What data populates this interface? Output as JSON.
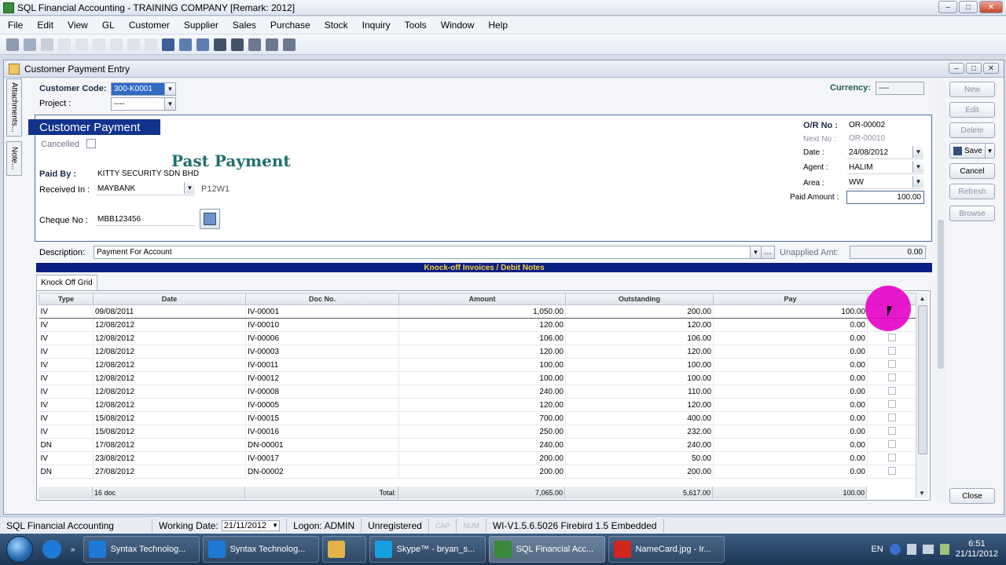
{
  "app": {
    "title": "SQL Financial Accounting - TRAINING COMPANY [Remark: 2012]",
    "window_buttons": [
      "–",
      "□",
      "✕"
    ]
  },
  "menu": [
    "File",
    "Edit",
    "View",
    "GL",
    "Customer",
    "Supplier",
    "Sales",
    "Purchase",
    "Stock",
    "Inquiry",
    "Tools",
    "Window",
    "Help"
  ],
  "child_window": {
    "title": "Customer Payment Entry",
    "side_tabs": [
      "Attachments...",
      "Note..."
    ]
  },
  "header": {
    "customer_code_label": "Customer Code:",
    "customer_code": "300-K0001",
    "project_label": "Project :",
    "project": "----",
    "currency_label": "Currency:",
    "currency": "----"
  },
  "form": {
    "section_title": "Customer Payment",
    "cancelled_label": "Cancelled",
    "watermark": "Past Payment",
    "paid_by_label": "Paid By :",
    "paid_by": "KITTY SECURITY SDN BHD",
    "received_in_label": "Received In :",
    "received_in": "MAYBANK",
    "received_in_code": "P12W1",
    "cheque_no_label": "Cheque No :",
    "cheque_no": "MBB123456",
    "or_no_label": "O/R No :",
    "or_no": "OR-00002",
    "next_no_label": "Next No :",
    "next_no": "OR-00010",
    "date_label": "Date :",
    "date": "24/08/2012",
    "agent_label": "Agent :",
    "agent": "HALIM",
    "area_label": "Area :",
    "area": "WW",
    "paid_amount_label": "Paid Amount :",
    "paid_amount": "100.00",
    "description_label": "Description:",
    "description": "Payment For Account",
    "unapplied_label": "Unapplied Amt:",
    "unapplied": "0.00",
    "ellipsis": "…"
  },
  "actions": {
    "new": "New",
    "edit": "Edit",
    "delete": "Delete",
    "save": "Save",
    "cancel": "Cancel",
    "refresh": "Refresh",
    "browse": "Browse",
    "close": "Close"
  },
  "knockoff": {
    "bar_title": "Knock-off Invoices / Debit Notes",
    "tab": "Knock Off Grid",
    "columns": [
      "Type",
      "Date",
      "Doc No.",
      "Amount",
      "Outstanding",
      "Pay"
    ],
    "rows": [
      [
        "IV",
        "09/08/2011",
        "IV-00001",
        "1,050.00",
        "200.00",
        "100.00"
      ],
      [
        "IV",
        "12/08/2012",
        "IV-00010",
        "120.00",
        "120.00",
        "0.00"
      ],
      [
        "IV",
        "12/08/2012",
        "IV-00006",
        "106.00",
        "106.00",
        "0.00"
      ],
      [
        "IV",
        "12/08/2012",
        "IV-00003",
        "120.00",
        "120.00",
        "0.00"
      ],
      [
        "IV",
        "12/08/2012",
        "IV-00011",
        "100.00",
        "100.00",
        "0.00"
      ],
      [
        "IV",
        "12/08/2012",
        "IV-00012",
        "100.00",
        "100.00",
        "0.00"
      ],
      [
        "IV",
        "12/08/2012",
        "IV-00008",
        "240.00",
        "110.00",
        "0.00"
      ],
      [
        "IV",
        "12/08/2012",
        "IV-00005",
        "120.00",
        "120.00",
        "0.00"
      ],
      [
        "IV",
        "15/08/2012",
        "IV-00015",
        "700.00",
        "400.00",
        "0.00"
      ],
      [
        "IV",
        "15/08/2012",
        "IV-00016",
        "250.00",
        "232.00",
        "0.00"
      ],
      [
        "DN",
        "17/08/2012",
        "DN-00001",
        "240.00",
        "240.00",
        "0.00"
      ],
      [
        "IV",
        "23/08/2012",
        "IV-00017",
        "200.00",
        "50.00",
        "0.00"
      ],
      [
        "DN",
        "27/08/2012",
        "DN-00002",
        "200.00",
        "200.00",
        "0.00"
      ]
    ],
    "footer": {
      "count": "16 doc",
      "total_label": "Total:",
      "amount": "7,065.00",
      "outstanding": "5,617.00",
      "pay": "100.00"
    }
  },
  "status": {
    "app": "SQL Financial Accounting",
    "working_date_label": "Working Date:",
    "working_date": "21/11/2012",
    "logon": "Logon: ADMIN",
    "registration": "Unregistered",
    "cap": "CAP",
    "num": "NUM",
    "version": "WI-V1.5.6.5026 Firebird 1.5 Embedded"
  },
  "taskbar": {
    "tasks": [
      {
        "label": "Syntax Technolog...",
        "color": "#1e7ad6"
      },
      {
        "label": "Syntax Technolog...",
        "color": "#1e7ad6"
      },
      {
        "label": "",
        "color": "#e3b24a"
      },
      {
        "label": "Skype™ - bryan_s...",
        "color": "#16a0e0"
      },
      {
        "label": "SQL Financial Acc...",
        "color": "#3a8a3a"
      },
      {
        "label": "NameCard.jpg - Ir...",
        "color": "#d0261e"
      }
    ],
    "lang": "EN",
    "time": "6:51",
    "date": "21/11/2012"
  }
}
